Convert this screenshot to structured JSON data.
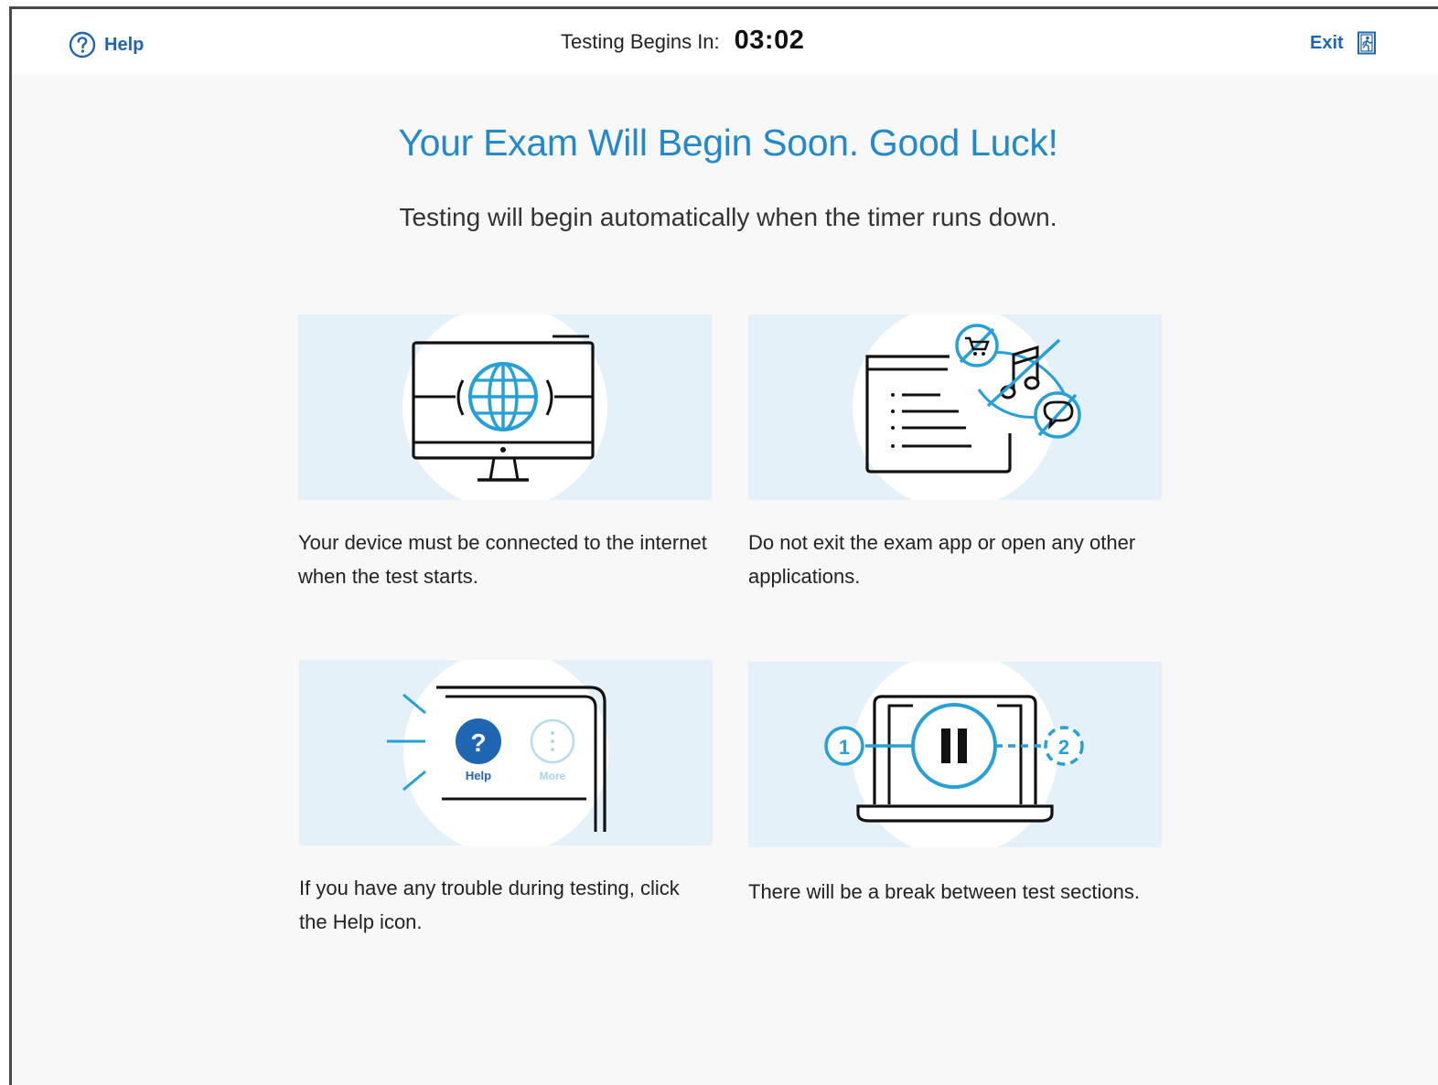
{
  "header": {
    "help_label": "Help",
    "timer_label": "Testing Begins In:",
    "timer_value": "03:02",
    "exit_label": "Exit"
  },
  "main": {
    "title": "Your Exam Will Begin Soon. Good Luck!",
    "subtitle": "Testing will begin automatically when the timer runs down.",
    "cards": [
      {
        "icon": "monitor-globe-icon",
        "text": "Your device must be connected to the internet when the test starts."
      },
      {
        "icon": "no-other-apps-icon",
        "text": "Do not exit the exam app or open any other applications."
      },
      {
        "icon": "help-button-icon",
        "text": "If you have any trouble during testing, click the Help icon.",
        "illus_help_label": "Help",
        "illus_more_label": "More"
      },
      {
        "icon": "pause-break-icon",
        "text": "There will be a break between test sections.",
        "illus_step_1": "1",
        "illus_step_2": "2"
      }
    ]
  },
  "colors": {
    "accent": "#2389cb",
    "link": "#1f66b2",
    "illustration_bg": "#e4f1f8",
    "illustration_blue": "#27a0d8"
  }
}
